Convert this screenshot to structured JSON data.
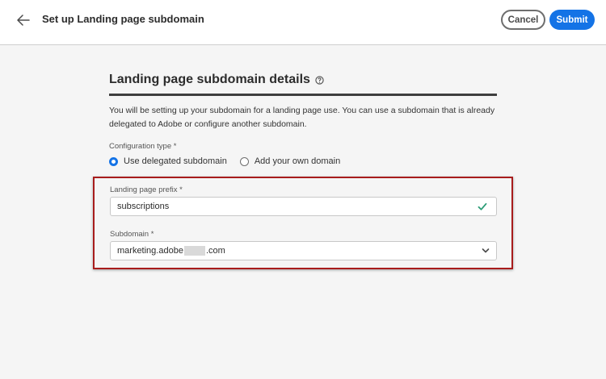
{
  "header": {
    "title": "Set up Landing page subdomain",
    "cancel_label": "Cancel",
    "submit_label": "Submit"
  },
  "section": {
    "title": "Landing page subdomain details",
    "description": "You will be setting up your subdomain for a landing page use. You can use a subdomain that is already delegated to Adobe or configure another subdomain."
  },
  "config_type": {
    "label": "Configuration type",
    "required_mark": "*",
    "options": [
      {
        "label": "Use delegated subdomain",
        "checked": true
      },
      {
        "label": "Add your own domain",
        "checked": false
      }
    ]
  },
  "prefix": {
    "label": "Landing page prefix",
    "required_mark": "*",
    "value": "subscriptions"
  },
  "subdomain": {
    "label": "Subdomain",
    "required_mark": "*",
    "value_start": "marketing.adobe",
    "value_end": ".com"
  },
  "icons": {
    "back": "arrow-left-icon",
    "help": "help-circle-icon",
    "valid": "checkmark-icon",
    "dropdown": "chevron-down-icon"
  },
  "colors": {
    "accent": "#1473e6",
    "valid": "#2d9d78",
    "highlight": "#a81c1c"
  }
}
